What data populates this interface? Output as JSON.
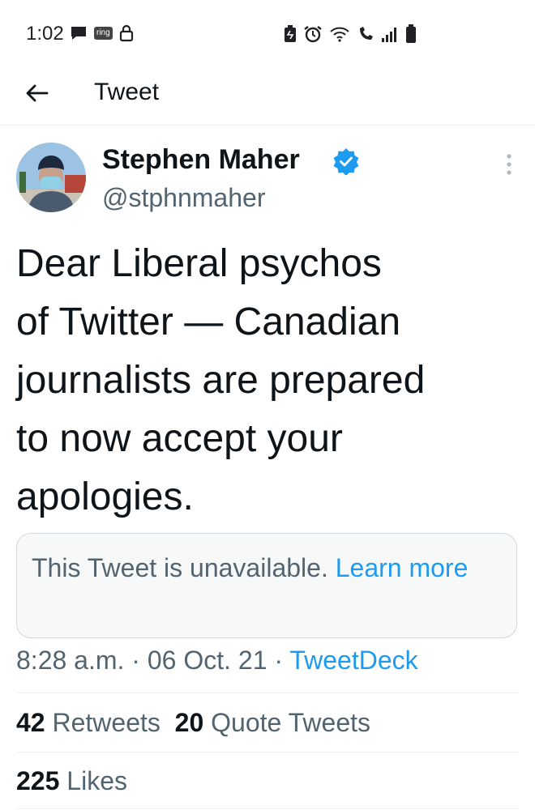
{
  "status_bar": {
    "time": "1:02",
    "ring_badge": "ring"
  },
  "header": {
    "title": "Tweet"
  },
  "tweet": {
    "author_name": "Stephen Maher",
    "author_handle": "@stphnmaher",
    "text_lines": [
      "Dear Liberal psychos",
      "of Twitter — Canadian",
      "journalists are prepared",
      "to now accept your",
      "apologies."
    ],
    "unavailable_text": "This Tweet is unavailable.",
    "learn_more": "Learn more",
    "time": "8:28 a.m.",
    "separator": "·",
    "date": "06 Oct. 21",
    "source": "TweetDeck",
    "retweets_count": "42",
    "retweets_label": "Retweets",
    "quotes_count": "20",
    "quotes_label": "Quote Tweets",
    "likes_count": "225",
    "likes_label": "Likes"
  },
  "colors": {
    "accent": "#1d9bf0",
    "text": "#0f1419",
    "secondary": "#536471"
  }
}
